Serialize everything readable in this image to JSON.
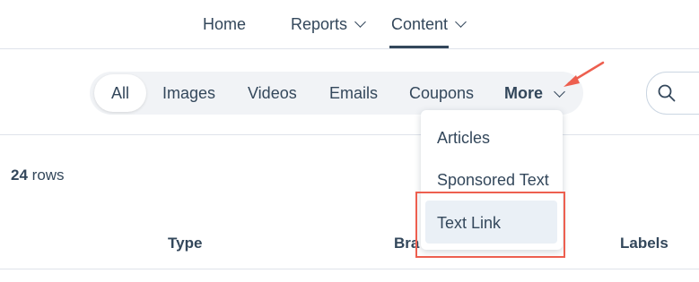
{
  "topnav": {
    "items": [
      "Home",
      "Reports",
      "Content"
    ],
    "active": "Content"
  },
  "filters": {
    "pills": [
      "All",
      "Images",
      "Videos",
      "Emails",
      "Coupons"
    ],
    "active": "All",
    "more_label": "More"
  },
  "dropdown": {
    "items": [
      "Articles",
      "Sponsored Text",
      "Text Link"
    ],
    "hovered": "Text Link"
  },
  "table": {
    "row_count": "24",
    "row_count_suffix": "rows",
    "columns": [
      "Type",
      "Bra",
      "Labels"
    ]
  },
  "annotation": {
    "color": "#ed5f4f"
  },
  "icons": [
    "chevron-down-icon",
    "search-icon",
    "annotation-arrow"
  ]
}
